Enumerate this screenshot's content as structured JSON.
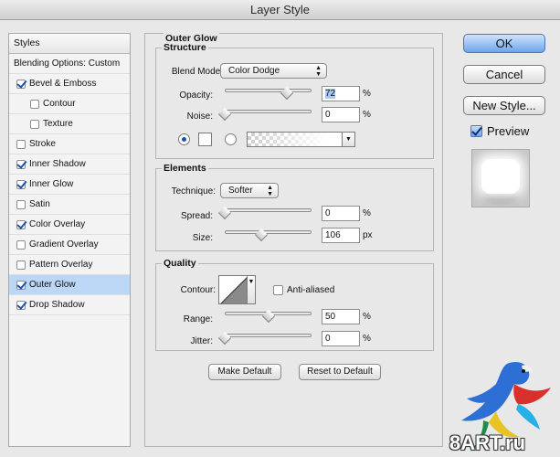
{
  "window": {
    "title": "Layer Style"
  },
  "styles_list": {
    "header": "Styles",
    "blending": "Blending Options: Custom",
    "items": [
      {
        "label": "Bevel & Emboss",
        "checked": true
      },
      {
        "label": "Contour",
        "checked": false,
        "sub": true
      },
      {
        "label": "Texture",
        "checked": false,
        "sub": true
      },
      {
        "label": "Stroke",
        "checked": false
      },
      {
        "label": "Inner Shadow",
        "checked": true
      },
      {
        "label": "Inner Glow",
        "checked": true
      },
      {
        "label": "Satin",
        "checked": false
      },
      {
        "label": "Color Overlay",
        "checked": true
      },
      {
        "label": "Gradient Overlay",
        "checked": false
      },
      {
        "label": "Pattern Overlay",
        "checked": false
      },
      {
        "label": "Outer Glow",
        "checked": true,
        "selected": true
      },
      {
        "label": "Drop Shadow",
        "checked": true
      }
    ]
  },
  "panel": {
    "title": "Outer Glow",
    "structure": {
      "title": "Structure",
      "blend_mode_label": "Blend Mode:",
      "blend_mode": "Color Dodge",
      "opacity_label": "Opacity:",
      "opacity": "72",
      "opacity_fraction": 0.72,
      "noise_label": "Noise:",
      "noise": "0",
      "noise_fraction": 0,
      "unit": "%"
    },
    "elements": {
      "title": "Elements",
      "technique_label": "Technique:",
      "technique": "Softer",
      "spread_label": "Spread:",
      "spread": "0",
      "spread_fraction": 0,
      "spread_unit": "%",
      "size_label": "Size:",
      "size": "106",
      "size_fraction": 0.42,
      "size_unit": "px"
    },
    "quality": {
      "title": "Quality",
      "contour_label": "Contour:",
      "antialiased_label": "Anti-aliased",
      "range_label": "Range:",
      "range": "50",
      "range_fraction": 0.5,
      "jitter_label": "Jitter:",
      "jitter": "0",
      "jitter_fraction": 0,
      "unit": "%"
    },
    "make_default": "Make Default",
    "reset_default": "Reset to Default"
  },
  "buttons": {
    "ok": "OK",
    "cancel": "Cancel",
    "new_style": "New Style...",
    "preview": "Preview"
  },
  "watermark": {
    "text": "8ART.ru"
  }
}
